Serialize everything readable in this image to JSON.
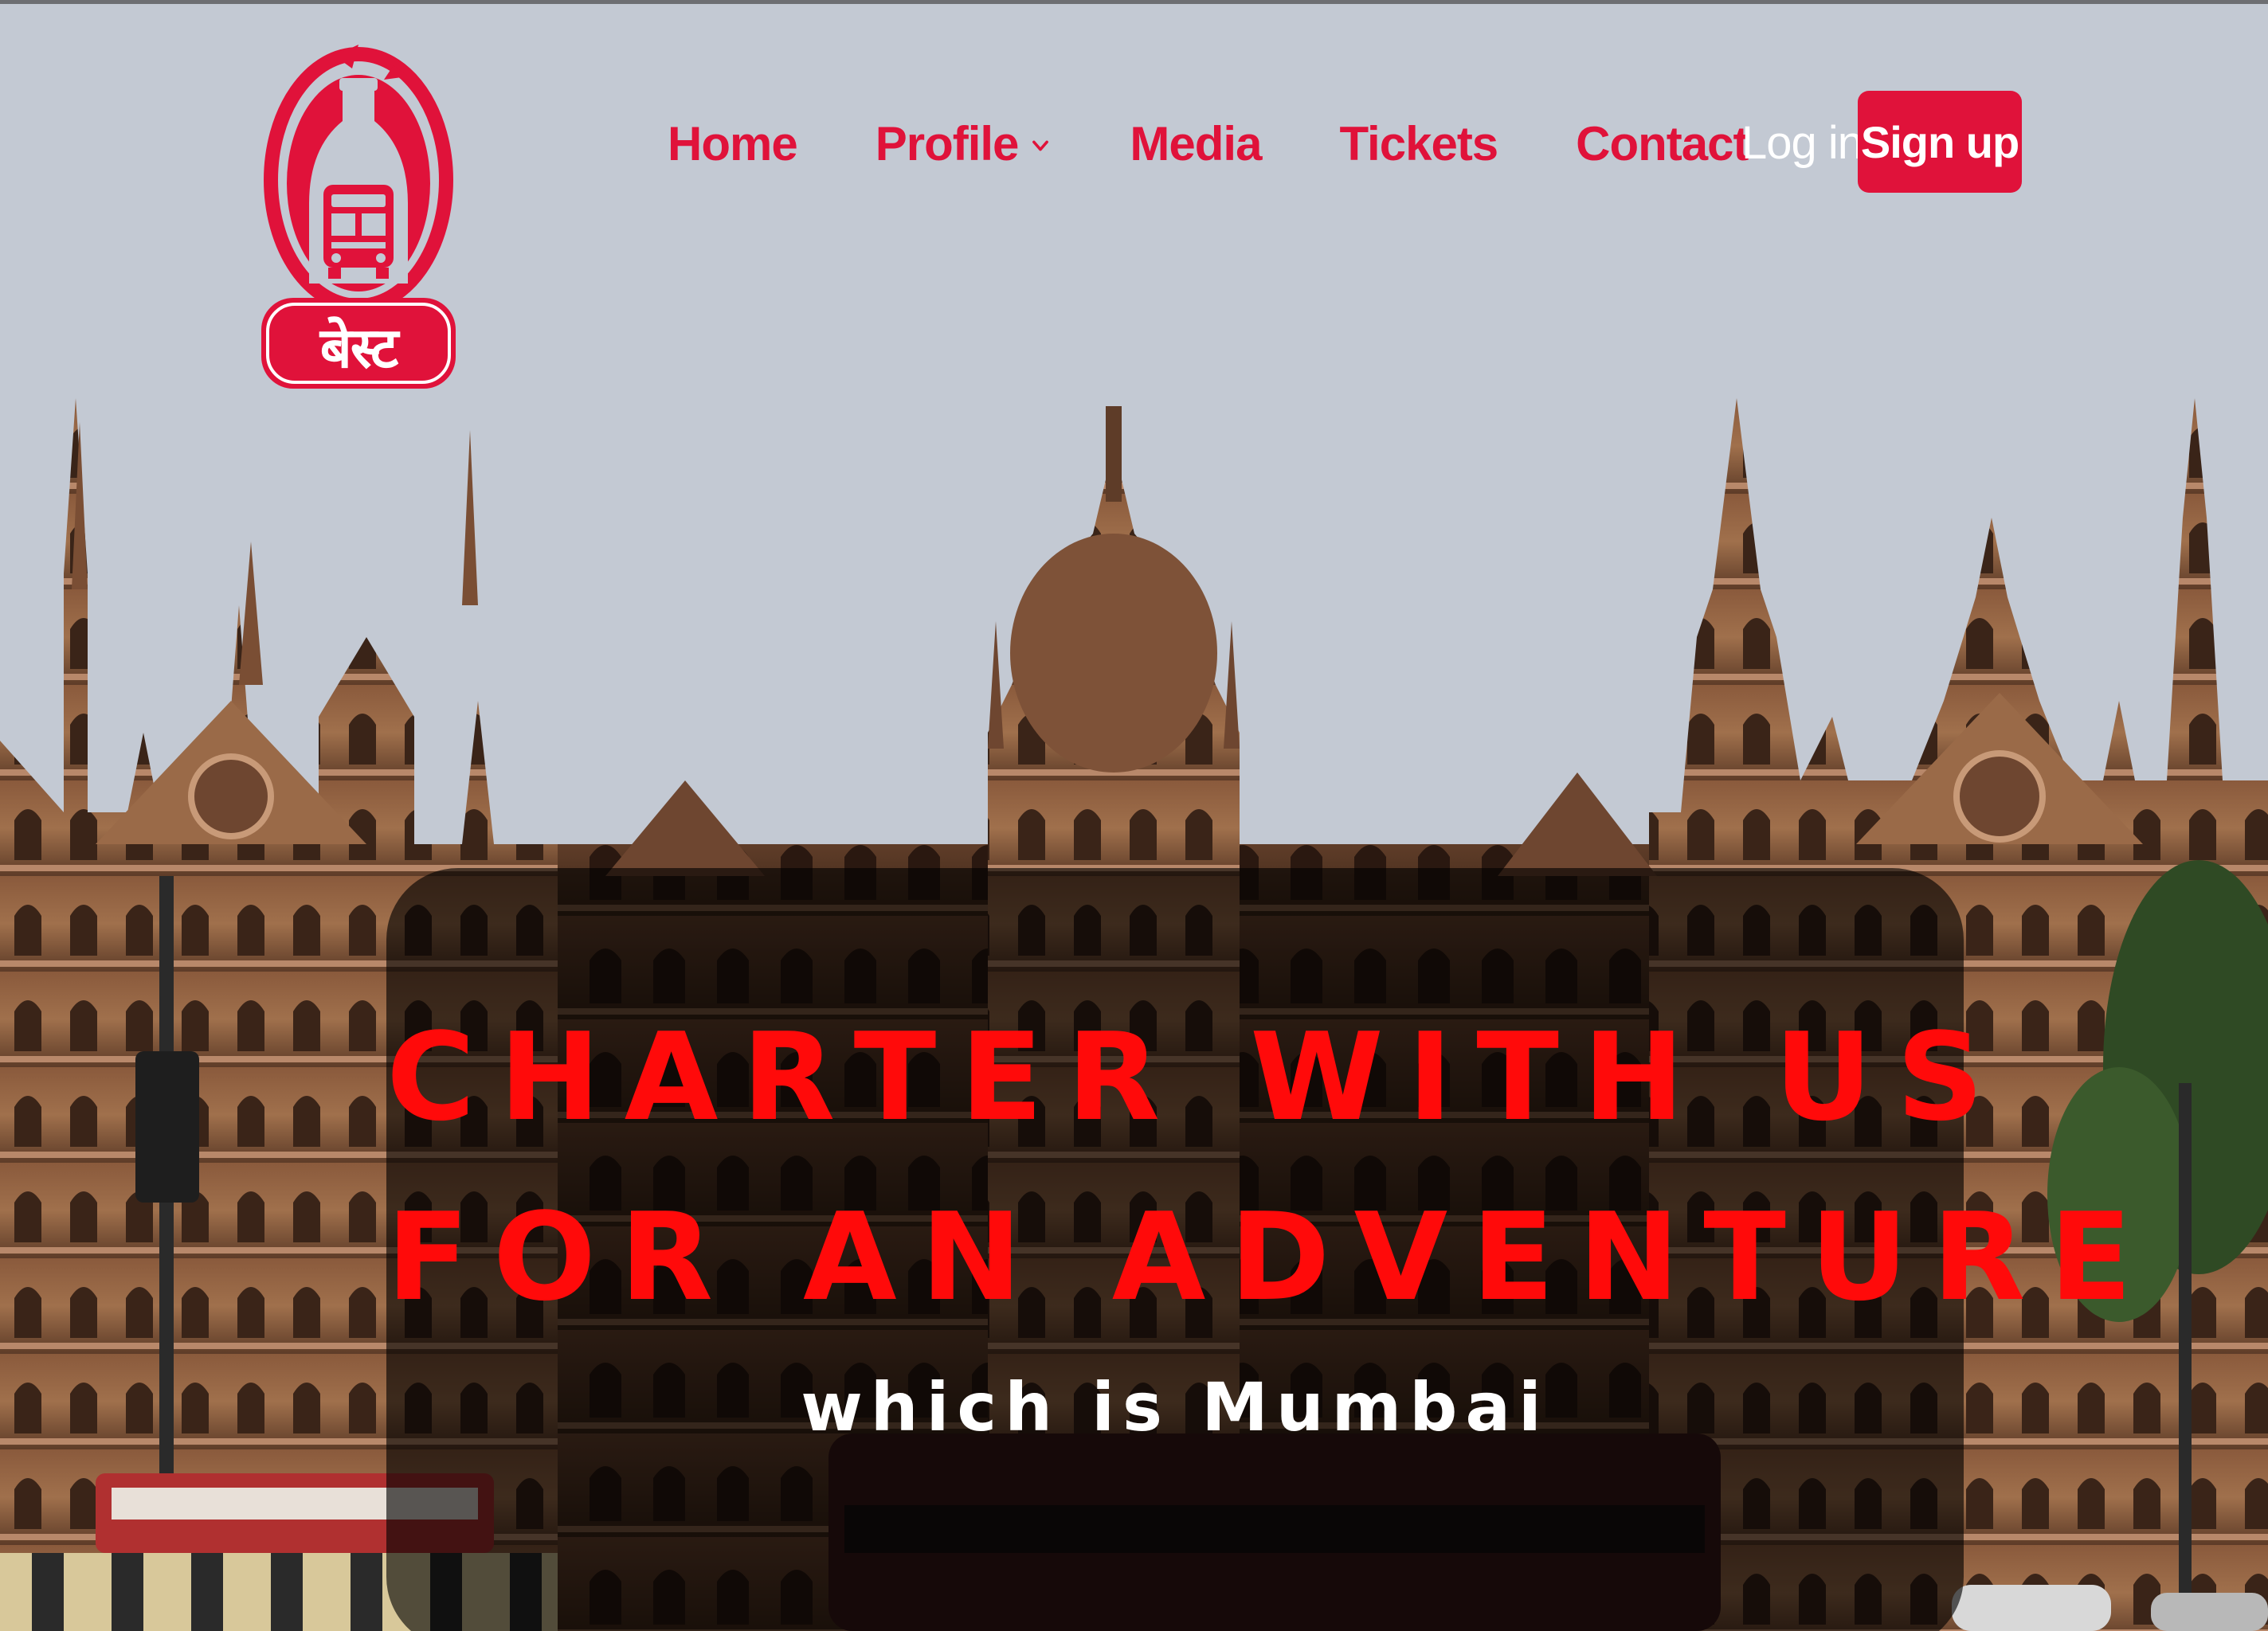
{
  "brand": {
    "logo_text": "बेस्ट",
    "color": "#e0123a"
  },
  "nav": {
    "items": [
      {
        "label": "Home"
      },
      {
        "label": "Profile",
        "has_dropdown": true,
        "icon": "chevron-down-icon"
      },
      {
        "label": "Media"
      },
      {
        "label": "Tickets"
      },
      {
        "label": "Contact"
      }
    ]
  },
  "auth": {
    "login_label": "Log in",
    "signup_label": "Sign up"
  },
  "hero": {
    "title_lines": [
      "CHARTER WITH US",
      "FOR AN ADVENTURE"
    ],
    "subtitle": "which is Mumbai",
    "title_color": "#ff0a0a",
    "overlay_color": "#000000",
    "background": "mumbai-heritage-building-photo"
  },
  "colors": {
    "page_background": "#c3c9d3",
    "accent": "#e0123a",
    "text_light": "#ffffff"
  }
}
